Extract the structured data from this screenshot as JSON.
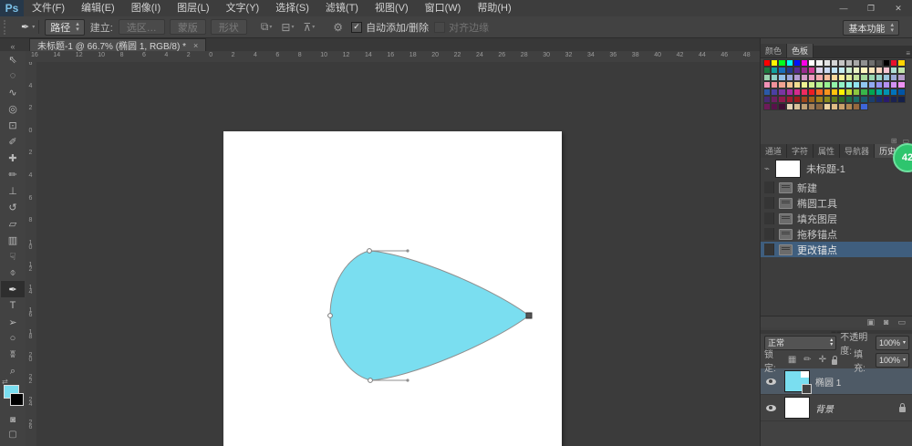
{
  "window": {
    "minimize": "—",
    "restore": "❐",
    "close": "✕",
    "workspace": "基本功能"
  },
  "menu": {
    "logo": "Ps",
    "items": [
      "文件(F)",
      "编辑(E)",
      "图像(I)",
      "图层(L)",
      "文字(Y)",
      "选择(S)",
      "滤镜(T)",
      "视图(V)",
      "窗口(W)",
      "帮助(H)"
    ]
  },
  "options": {
    "tool_icon": "✒",
    "tool_mode": "路径",
    "make_label": "建立:",
    "make_buttons": [
      "选区…",
      "蒙版",
      "形状"
    ],
    "ops_icons": [
      {
        "name": "path-operations-icon",
        "glyph": "⧉"
      },
      {
        "name": "path-align-icon",
        "glyph": "⊟"
      },
      {
        "name": "path-arrange-icon",
        "glyph": "⊼"
      }
    ],
    "gear_icon": "⚙",
    "check_glyph": "✓",
    "auto_add": "自动添加/删除",
    "align_edges": "对齐边缘"
  },
  "tab": {
    "collapse": "«",
    "title": "未标题-1 @ 66.7% (椭圆 1, RGB/8) *",
    "close": "×"
  },
  "tools": [
    {
      "name": "move-tool",
      "glyph": "⇖"
    },
    {
      "name": "marquee-tool",
      "glyph": "◌"
    },
    {
      "name": "lasso-tool",
      "glyph": "∿"
    },
    {
      "name": "quick-selection-tool",
      "glyph": "◎"
    },
    {
      "name": "crop-tool",
      "glyph": "⊡"
    },
    {
      "name": "eyedropper-tool",
      "glyph": "✐"
    },
    {
      "name": "healing-brush-tool",
      "glyph": "✚"
    },
    {
      "name": "brush-tool",
      "glyph": "✏"
    },
    {
      "name": "clone-stamp-tool",
      "glyph": "⊥"
    },
    {
      "name": "history-brush-tool",
      "glyph": "↺"
    },
    {
      "name": "eraser-tool",
      "glyph": "▱"
    },
    {
      "name": "gradient-tool",
      "glyph": "▥"
    },
    {
      "name": "smudge-tool",
      "glyph": "☟"
    },
    {
      "name": "dodge-tool",
      "glyph": "⌽"
    },
    {
      "name": "pen-tool",
      "glyph": "✒",
      "selected": true
    },
    {
      "name": "type-tool",
      "glyph": "T"
    },
    {
      "name": "path-selection-tool",
      "glyph": "➢"
    },
    {
      "name": "ellipse-shape-tool",
      "glyph": "○"
    },
    {
      "name": "hand-tool",
      "glyph": "ʬ"
    },
    {
      "name": "zoom-tool",
      "glyph": "⌕"
    }
  ],
  "colors": {
    "foreground": "#7adef0",
    "background": "#000000",
    "shape_fill": "#7adef0",
    "shape_stroke": "#8f8f8f",
    "history_selected": "#3f5e7e",
    "badge_green": "#2ec56e"
  },
  "rulers": {
    "top": [
      "16",
      "14",
      "12",
      "10",
      "8",
      "6",
      "4",
      "2",
      "0",
      "2",
      "4",
      "6",
      "8",
      "10",
      "12",
      "14",
      "16",
      "18",
      "20",
      "22",
      "24",
      "26",
      "28",
      "30",
      "32",
      "34",
      "36",
      "38",
      "40",
      "42",
      "44",
      "46",
      "48"
    ],
    "left": [
      "6",
      "4",
      "2",
      "0",
      "2",
      "4",
      "6",
      "8",
      "10",
      "12",
      "14",
      "16",
      "18",
      "20",
      "22",
      "24",
      "26"
    ]
  },
  "panels": {
    "swatches": {
      "tabs": [
        "颜色",
        "色板"
      ],
      "active_tab": "色板",
      "menu_icon": "≡",
      "foot_icons": [
        {
          "name": "new-swatch-icon",
          "glyph": "⊞"
        },
        {
          "name": "delete-swatch-icon",
          "glyph": "▭"
        }
      ],
      "rows": [
        [
          "#ff0000",
          "#fff600",
          "#00ff1e",
          "#00fff6",
          "#0012ff",
          "#ff00e4",
          "#ffffff",
          "#f2f2f2",
          "#e3e3e3",
          "#d4d4d4",
          "#c5c5c5",
          "#b6b6b6",
          "#a7a7a7",
          "#909090",
          "#6f6f6f",
          "#4d4d4d",
          "#000000",
          "#e8112d",
          "#ffd400"
        ],
        [
          "#1d7a3e",
          "#11a3a0",
          "#1a6fbc",
          "#243a8f",
          "#5b2d90",
          "#9c2a90",
          "#d43d96",
          "#dcd3ea",
          "#cbd9f2",
          "#c0e3f4",
          "#c5ecf2",
          "#ccebcc",
          "#e9f3c4",
          "#fdf6bf",
          "#fae5ba",
          "#f8d4c0",
          "#f5c3d1",
          "#aeddd2",
          "#bfe4aa"
        ],
        [
          "#9bd4af",
          "#90d1c9",
          "#93c0e9",
          "#9ba9dd",
          "#b49cd2",
          "#d59cc9",
          "#ed9cc1",
          "#f3aaad",
          "#f7bd9c",
          "#fbd99c",
          "#fdf19c",
          "#e3eb9c",
          "#c5e39c",
          "#a7db9c",
          "#9ad7b1",
          "#9ad3c9",
          "#9ac5dd",
          "#9ca9d5",
          "#b49cc9"
        ],
        [
          "#f291b6",
          "#f2919a",
          "#f2a391",
          "#f2c091",
          "#f2dd91",
          "#eef291",
          "#d1f291",
          "#b4f291",
          "#97f291",
          "#91f2a9",
          "#91f2c6",
          "#91f2e3",
          "#91e3f2",
          "#91c6f2",
          "#91a9f2",
          "#9791f2",
          "#b491f2",
          "#d191f2",
          "#ee91f2"
        ],
        [
          "#2b59a8",
          "#4b3fa5",
          "#7a35a2",
          "#a82b9f",
          "#d62b8e",
          "#ef2b60",
          "#ed1c24",
          "#f26522",
          "#f7941d",
          "#ffc20e",
          "#fff200",
          "#c5d92d",
          "#8dc63f",
          "#39b54a",
          "#00a651",
          "#00a99d",
          "#0093b2",
          "#0072bc",
          "#0054a6"
        ],
        [
          "#472a74",
          "#6d1f62",
          "#8f1a4e",
          "#a01c30",
          "#9e1b1b",
          "#a0461b",
          "#a0641b",
          "#a0821b",
          "#8a8a1b",
          "#5f7c1e",
          "#2f6d26",
          "#1b6d4a",
          "#1b6d68",
          "#1b5a6d",
          "#1b3f6d",
          "#1b2a6d",
          "#2a1b6d",
          "#1b2351",
          "#14204a"
        ],
        [
          "#6d1b5a",
          "#58124a",
          "#3f0e35",
          "#e3d2b4",
          "#d8c29a",
          "#c0a276",
          "#a6825a",
          "#8a6844",
          "#ecd2a0",
          "#e0bc86",
          "#c9a06a",
          "#b08652",
          "#96683e",
          "#3e66d8",
          null,
          null,
          null,
          null,
          null
        ]
      ]
    },
    "history": {
      "tabs": [
        "通道",
        "字符",
        "属性",
        "导航器",
        "历史记录"
      ],
      "active_tab": "历史记录",
      "menu_icon": "≡",
      "snapshot": "未标题-1",
      "states": [
        {
          "label": "新建"
        },
        {
          "label": "椭圆工具"
        },
        {
          "label": "填充图层"
        },
        {
          "label": "拖移锚点"
        },
        {
          "label": "更改锚点",
          "selected": true
        }
      ],
      "foot_icons": [
        {
          "name": "new-document-from-state-icon",
          "glyph": "▣"
        },
        {
          "name": "new-snapshot-icon",
          "glyph": "◙"
        },
        {
          "name": "delete-state-icon",
          "glyph": "▭"
        }
      ]
    },
    "layers": {
      "blend_mode": "正常",
      "opacity_label": "不透明度:",
      "opacity": "100%",
      "lock_label": "锁定:",
      "lock_icons": [
        {
          "name": "lock-transparency-icon",
          "glyph": "▦"
        },
        {
          "name": "lock-pixels-icon",
          "glyph": "✏"
        },
        {
          "name": "lock-position-icon",
          "glyph": "✛"
        }
      ],
      "fill_label": "填充:",
      "fill": "100%",
      "items": [
        {
          "name": "椭圆 1",
          "type": "shape",
          "selected": true
        },
        {
          "name": "背景",
          "type": "background",
          "locked": true
        }
      ]
    }
  },
  "badge": {
    "text": "42"
  }
}
